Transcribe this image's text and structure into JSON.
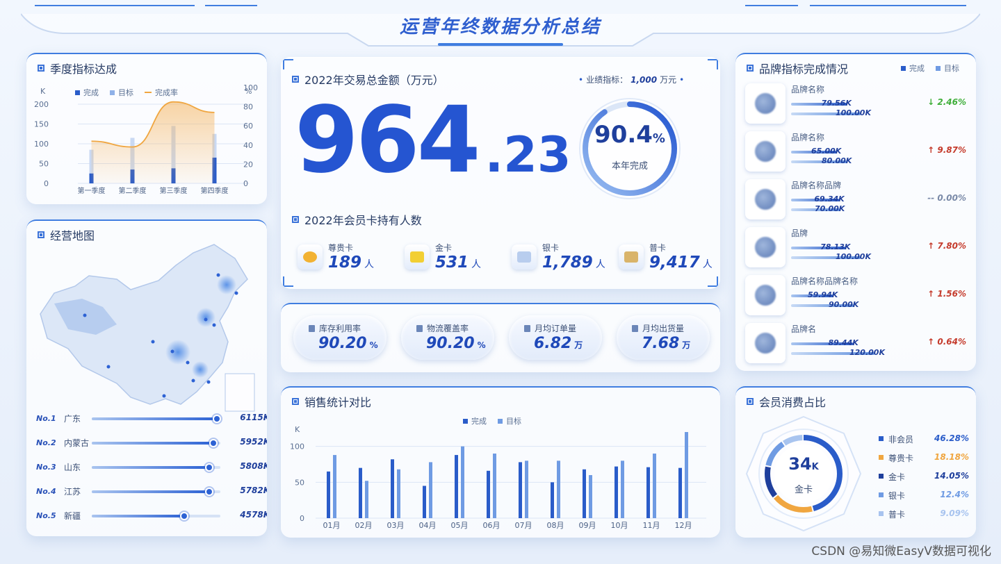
{
  "header": {
    "title": "运营年终数据分析总结"
  },
  "colors": {
    "accent": "#2f5fcf",
    "done": "#2a5cc9",
    "target": "#6f9be3",
    "rate": "#f0a640",
    "up": "#c53b2c",
    "down": "#3fae3a",
    "flat": "#7a8aa8"
  },
  "quarter": {
    "title": "季度指标达成",
    "unit_left": "K",
    "unit_right": "%",
    "legend": [
      "完成",
      "目标",
      "完成率"
    ],
    "left_ticks": [
      "200",
      "150",
      "100",
      "50",
      "0"
    ],
    "right_ticks": [
      "100",
      "80",
      "60",
      "40",
      "20",
      "0"
    ]
  },
  "map": {
    "title": "经营地图",
    "ranks": [
      {
        "no": "No.1",
        "name": "广东",
        "value": "6115K",
        "fraction": 1.0
      },
      {
        "no": "No.2",
        "name": "内蒙古",
        "value": "5952K",
        "fraction": 0.97
      },
      {
        "no": "No.3",
        "name": "山东",
        "value": "5808K",
        "fraction": 0.94
      },
      {
        "no": "No.4",
        "name": "江苏",
        "value": "5782K",
        "fraction": 0.94
      },
      {
        "no": "No.5",
        "name": "新疆",
        "value": "4578K",
        "fraction": 0.74
      }
    ]
  },
  "center": {
    "title": "2022年交易总金额（万元）",
    "target_label": "业绩指标：",
    "target_value": "1,000",
    "target_unit": "万元",
    "big_int": "964",
    "big_dec": ".23",
    "gauge_value": "90.4",
    "gauge_pct": "%",
    "gauge_fraction": 0.904,
    "gauge_label": "本年完成",
    "member_title": "2022年会员卡持有人数",
    "cards": [
      {
        "label": "尊贵卡",
        "value": "189",
        "unit": "人",
        "icon": "crown-icon"
      },
      {
        "label": "金卡",
        "value": "531",
        "unit": "人",
        "icon": "gold-card-icon"
      },
      {
        "label": "银卡",
        "value": "1,789",
        "unit": "人",
        "icon": "silver-card-icon"
      },
      {
        "label": "普卡",
        "value": "9,417",
        "unit": "人",
        "icon": "normal-card-icon"
      }
    ]
  },
  "kpis": [
    {
      "label": "库存利用率",
      "value": "90.20",
      "unit": "%"
    },
    {
      "label": "物流覆盖率",
      "value": "90.20",
      "unit": "%"
    },
    {
      "label": "月均订单量",
      "value": "6.82",
      "unit": "万"
    },
    {
      "label": "月均出货量",
      "value": "7.68",
      "unit": "万"
    }
  ],
  "sales": {
    "title": "销售统计对比",
    "unit": "K",
    "legend": [
      "完成",
      "目标"
    ],
    "ticks": [
      "100",
      "50",
      "0"
    ]
  },
  "brands": {
    "title": "品牌指标完成情况",
    "legend": [
      "完成",
      "目标"
    ],
    "rows": [
      {
        "name": "品牌名称",
        "done": "79.56K",
        "target": "100.00K",
        "change": "↓ 2.46%",
        "dir": "down",
        "done_v": 79.56,
        "target_v": 100
      },
      {
        "name": "品牌名称",
        "done": "65.00K",
        "target": "80.00K",
        "change": "↑ 9.87%",
        "dir": "up",
        "done_v": 65.0,
        "target_v": 80
      },
      {
        "name": "品牌名称品牌",
        "done": "69.34K",
        "target": "70.00K",
        "change": "-- 0.00%",
        "dir": "flat",
        "done_v": 69.34,
        "target_v": 70
      },
      {
        "name": "品牌",
        "done": "78.13K",
        "target": "100.00K",
        "change": "↑ 7.80%",
        "dir": "up",
        "done_v": 78.13,
        "target_v": 100
      },
      {
        "name": "品牌名称品牌名称",
        "done": "59.94K",
        "target": "90.00K",
        "change": "↑ 1.56%",
        "dir": "up",
        "done_v": 59.94,
        "target_v": 90
      },
      {
        "name": "品牌名",
        "done": "89.44K",
        "target": "120.00K",
        "change": "↑ 0.64%",
        "dir": "up",
        "done_v": 89.44,
        "target_v": 120
      }
    ]
  },
  "members": {
    "title": "会员消费占比",
    "center_value": "34",
    "center_unit": "K",
    "center_label": "金卡",
    "rows": [
      {
        "name": "非会员",
        "pct": "46.28%",
        "color": "#2a5cc9"
      },
      {
        "name": "尊贵卡",
        "pct": "18.18%",
        "color": "#f0a640"
      },
      {
        "name": "金卡",
        "pct": "14.05%",
        "color": "#1f3f9c"
      },
      {
        "name": "银卡",
        "pct": "12.4%",
        "color": "#6f9be3"
      },
      {
        "name": "普卡",
        "pct": "9.09%",
        "color": "#a8c4ef"
      }
    ]
  },
  "footer": "CSDN @易知微EasyV数据可视化",
  "chart_data": [
    {
      "type": "bar",
      "categories": [
        "第一季度",
        "第二季度",
        "第三季度",
        "第四季度"
      ],
      "series": [
        {
          "name": "完成",
          "values": [
            25,
            35,
            38,
            65
          ]
        },
        {
          "name": "目标",
          "values": [
            85,
            115,
            145,
            125
          ]
        },
        {
          "name": "完成率",
          "values": [
            44,
            38,
            85,
            74
          ]
        }
      ],
      "ylabel": "K",
      "ylim": [
        0,
        200
      ],
      "y2lim": [
        0,
        100
      ]
    },
    {
      "type": "bar",
      "categories": [
        "01月",
        "02月",
        "03月",
        "04月",
        "05月",
        "06月",
        "07月",
        "08月",
        "09月",
        "10月",
        "11月",
        "12月"
      ],
      "series": [
        {
          "name": "完成",
          "values": [
            65,
            70,
            82,
            45,
            88,
            66,
            78,
            50,
            68,
            72,
            71,
            70
          ]
        },
        {
          "name": "目标",
          "values": [
            88,
            52,
            68,
            78,
            100,
            90,
            80,
            80,
            60,
            80,
            90,
            120
          ]
        }
      ],
      "ylabel": "K",
      "ylim": [
        0,
        120
      ]
    },
    {
      "type": "pie",
      "categories": [
        "非会员",
        "尊贵卡",
        "金卡",
        "银卡",
        "普卡"
      ],
      "values": [
        46.28,
        18.18,
        14.05,
        12.4,
        9.09
      ]
    }
  ]
}
